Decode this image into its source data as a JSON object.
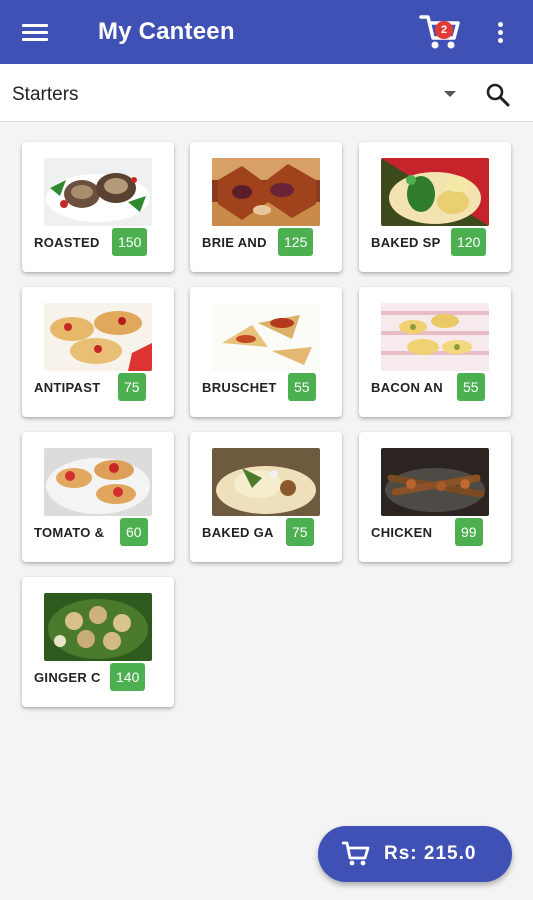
{
  "app": {
    "title": "My Canteen",
    "cart_count": "2",
    "primary_color": "#3f51b5",
    "price_color": "#4caf50",
    "badge_color": "#e53935"
  },
  "category": {
    "selected": "Starters"
  },
  "icons": {
    "menu": "hamburger-menu-icon",
    "cart": "shopping-cart-icon",
    "more": "more-vertical-icon",
    "search": "search-icon",
    "dropdown": "caret-down-icon"
  },
  "items": [
    {
      "name": "ROASTED",
      "price": "150"
    },
    {
      "name": "BRIE AND",
      "price": "125"
    },
    {
      "name": "BAKED SP",
      "price": "120"
    },
    {
      "name": "ANTIPAST",
      "price": "75"
    },
    {
      "name": "BRUSCHET",
      "price": "55"
    },
    {
      "name": "BACON AN",
      "price": "55"
    },
    {
      "name": "TOMATO &",
      "price": "60"
    },
    {
      "name": "BAKED GA",
      "price": "75"
    },
    {
      "name": "CHICKEN",
      "price": "99"
    },
    {
      "name": "GINGER C",
      "price": "140"
    }
  ],
  "checkout": {
    "total": "Rs: 215.0"
  }
}
